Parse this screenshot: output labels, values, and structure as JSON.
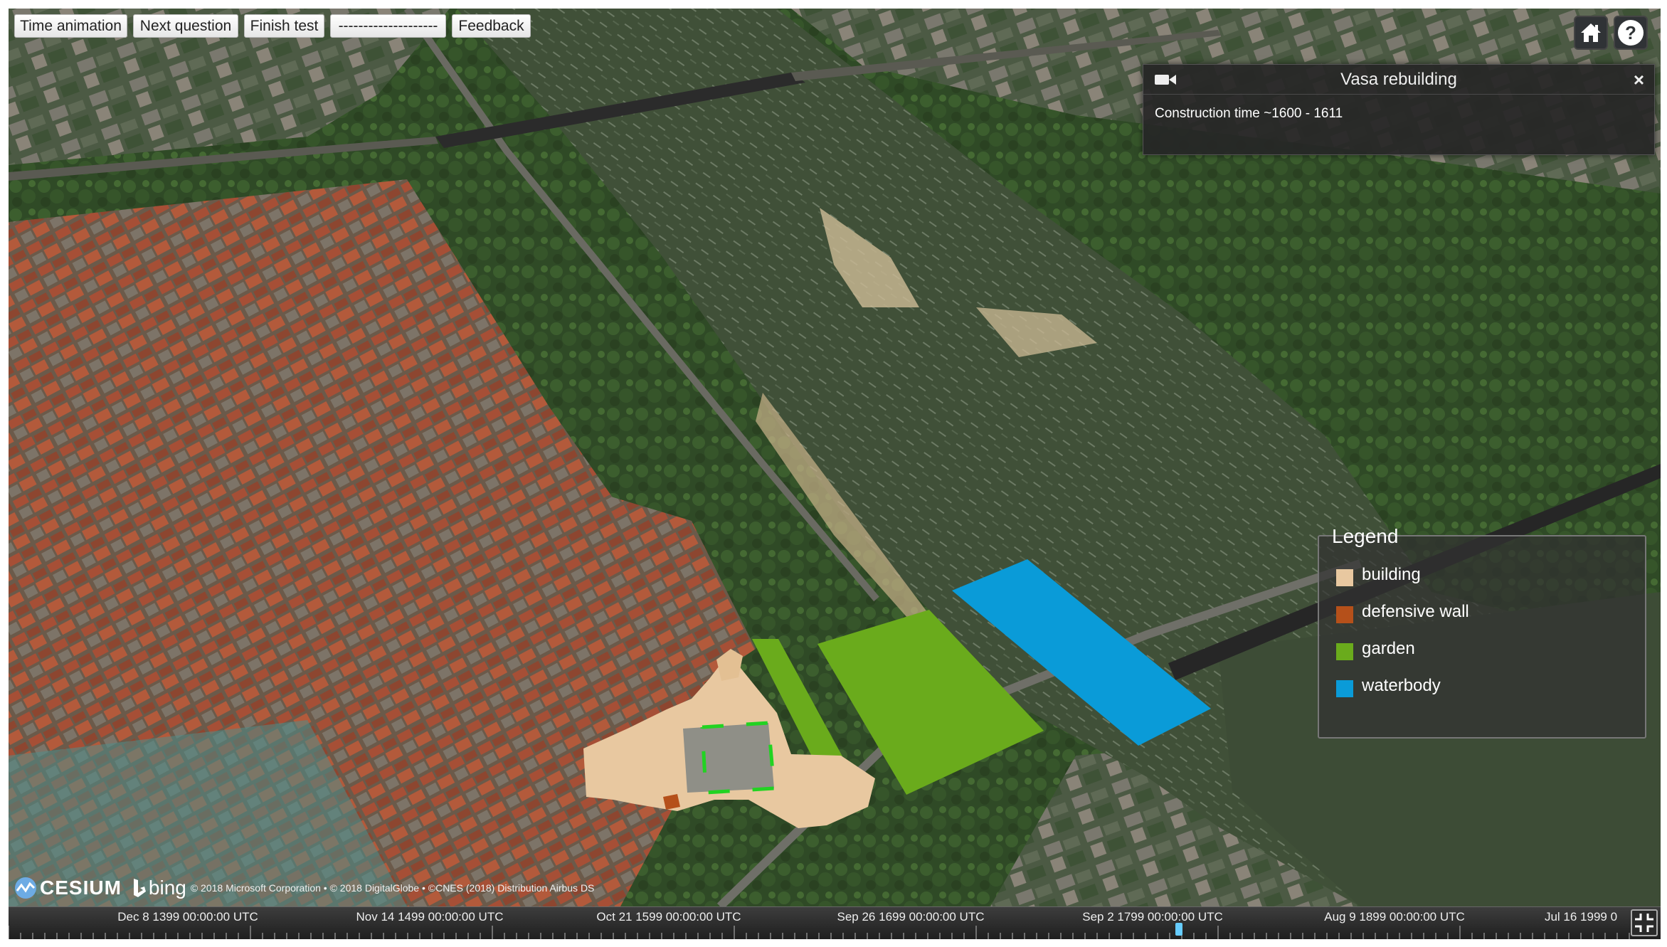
{
  "toolbar": {
    "time_animation": "Time animation",
    "next_question": "Next question",
    "finish_test": "Finish test",
    "separator": "--------------------",
    "feedback": "Feedback"
  },
  "corner_buttons": {
    "home_icon": "home-icon",
    "help_icon": "help-icon",
    "help_glyph": "?"
  },
  "infobox": {
    "title": "Vasa rebuilding",
    "close": "×",
    "description": "Construction time ~1600 - 1611"
  },
  "legend": {
    "title": "Legend",
    "items": [
      {
        "label": "building",
        "color": "#e8c8a0"
      },
      {
        "label": "defensive wall",
        "color": "#b5501a"
      },
      {
        "label": "garden",
        "color": "#6aab1c"
      },
      {
        "label": "waterbody",
        "color": "#0a9bd8"
      }
    ]
  },
  "credits": {
    "cesium": "CESIUM",
    "bing": "bing",
    "attribution": "© 2018 Microsoft Corporation • © 2018 DigitalGlobe • ©CNES (2018) Distribution Airbus DS"
  },
  "timeline": {
    "labels": [
      "Dec 8 1399 00:00:00 UTC",
      "Nov 14 1499 00:00:00 UTC",
      "Oct 21 1599 00:00:00 UTC",
      "Sep 26 1699 00:00:00 UTC",
      "Sep 2 1799 00:00:00 UTC",
      "Aug 9 1899 00:00:00 UTC",
      "Jul 16 1999 0"
    ]
  },
  "colors": {
    "river": "#3f4e36",
    "vegetation": "#34502a",
    "roof_red": "#9c4a34",
    "building": "#e8c8a0",
    "garden": "#6aab1c",
    "waterbody": "#0a9bd8",
    "selection": "#22d322"
  }
}
